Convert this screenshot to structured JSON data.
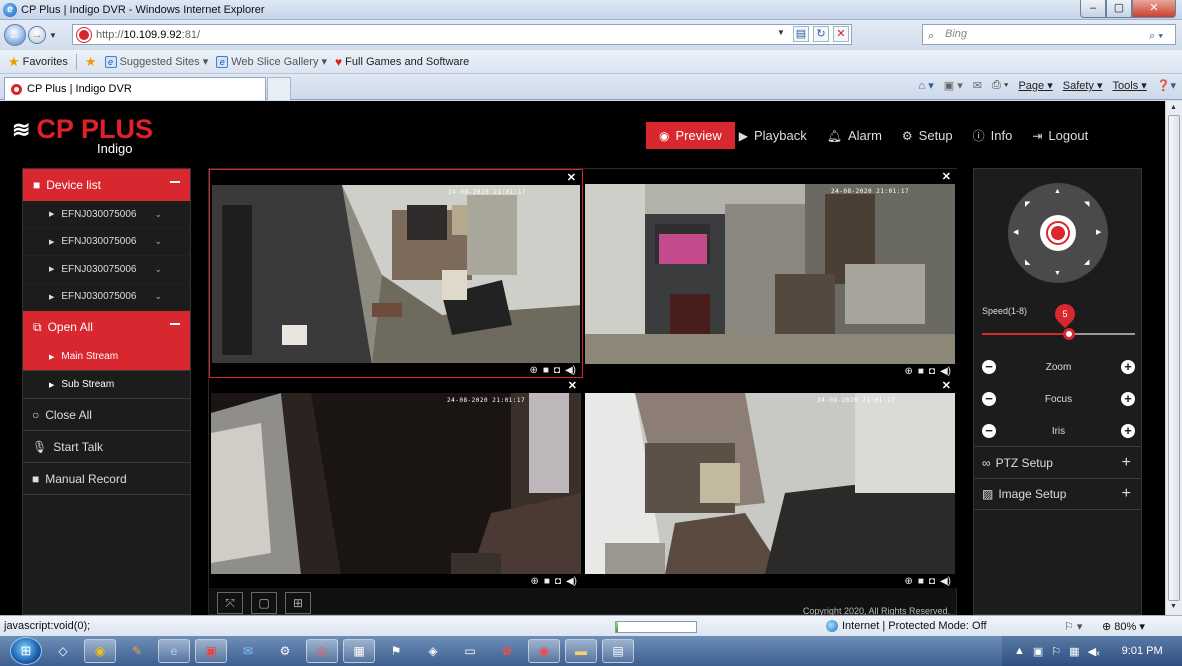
{
  "window": {
    "title": "CP Plus | Indigo DVR - Windows Internet Explorer"
  },
  "address": {
    "prefix": "http://",
    "host": "10.109.9.92",
    "suffix": ":81/"
  },
  "search": {
    "placeholder": "Bing"
  },
  "favorites": {
    "favorites_label": "Favorites",
    "items": [
      "Suggested Sites ▾",
      "Web Slice Gallery ▾",
      "Full Games and Software"
    ]
  },
  "tab": {
    "title": "CP Plus | Indigo DVR"
  },
  "commandbar": {
    "page": "Page ▾",
    "safety": "Safety ▾",
    "tools": "Tools ▾"
  },
  "app": {
    "brand": "CP PLUS",
    "sub_brand": "Indigo",
    "nav": [
      "Preview",
      "Playback",
      "Alarm",
      "Setup",
      "Info",
      "Logout"
    ],
    "nav_active": "Preview",
    "sidebar": {
      "device_list": "Device list",
      "devices": [
        "EFNJ030075006",
        "EFNJ030075006",
        "EFNJ030075006",
        "EFNJ030075006"
      ],
      "open_all": "Open All",
      "streams": [
        "Main Stream",
        "Sub Stream"
      ],
      "selected_stream": "Main Stream",
      "close_all": "Close All",
      "start_talk": "Start Talk",
      "manual_record": "Manual Record"
    },
    "video": {
      "timestamps": [
        "24-08-2020 21:01:17",
        "24-08-2020 21:01:17",
        "24-08-2020 21:01:17",
        "24-08-2020 21:01:17"
      ],
      "copyright": "Copyright 2020, All Rights Reserved."
    },
    "ptz": {
      "speed_label": "Speed(1-8)",
      "speed_value": "5",
      "speed_min": 1,
      "speed_max": 8,
      "zoom": "Zoom",
      "focus": "Focus",
      "iris": "Iris",
      "ptz_setup": "PTZ Setup",
      "image_setup": "Image Setup"
    }
  },
  "status": {
    "text": "javascript:void(0);",
    "progress": 0.03,
    "zone": "Internet | Protected Mode: Off",
    "zoom": "80%"
  },
  "taskbar": {
    "clock": "9:01 PM"
  },
  "colors": {
    "accent": "#d8272e",
    "app_bg": "#000000",
    "panel_bg": "#1c1c1c"
  }
}
